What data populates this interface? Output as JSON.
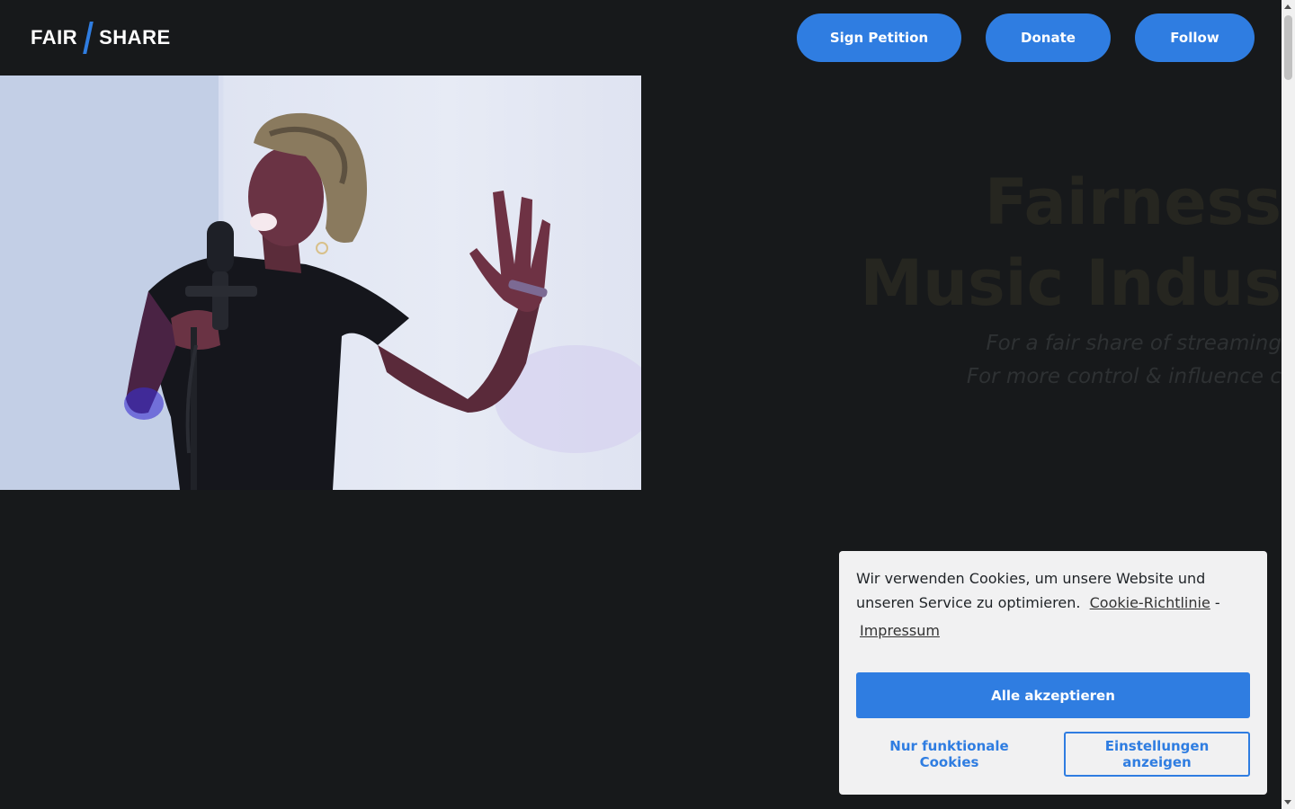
{
  "header": {
    "logo_left": "FAIR",
    "logo_right": "SHARE",
    "nav": {
      "sign_petition": "Sign Petition",
      "donate": "Donate",
      "follow": "Follow"
    }
  },
  "hero": {
    "title_line1": "Fairness",
    "title_line2": "Music Indus",
    "subtitle_line1": "For a fair share of streaming",
    "subtitle_line2": "For more control & influence c"
  },
  "cookie_banner": {
    "message": "Wir verwenden Cookies, um unsere Website und unseren Service zu optimieren.",
    "policy_link": "Cookie-Richtlinie",
    "separator": "-",
    "impressum_link": "Impressum",
    "accept_all": "Alle akzeptieren",
    "functional_only": "Nur funktionale Cookies",
    "show_settings": "Einstellungen anzeigen"
  },
  "colors": {
    "accent": "#2f7de1",
    "background": "#17191b",
    "banner": "#f1f1f2"
  }
}
